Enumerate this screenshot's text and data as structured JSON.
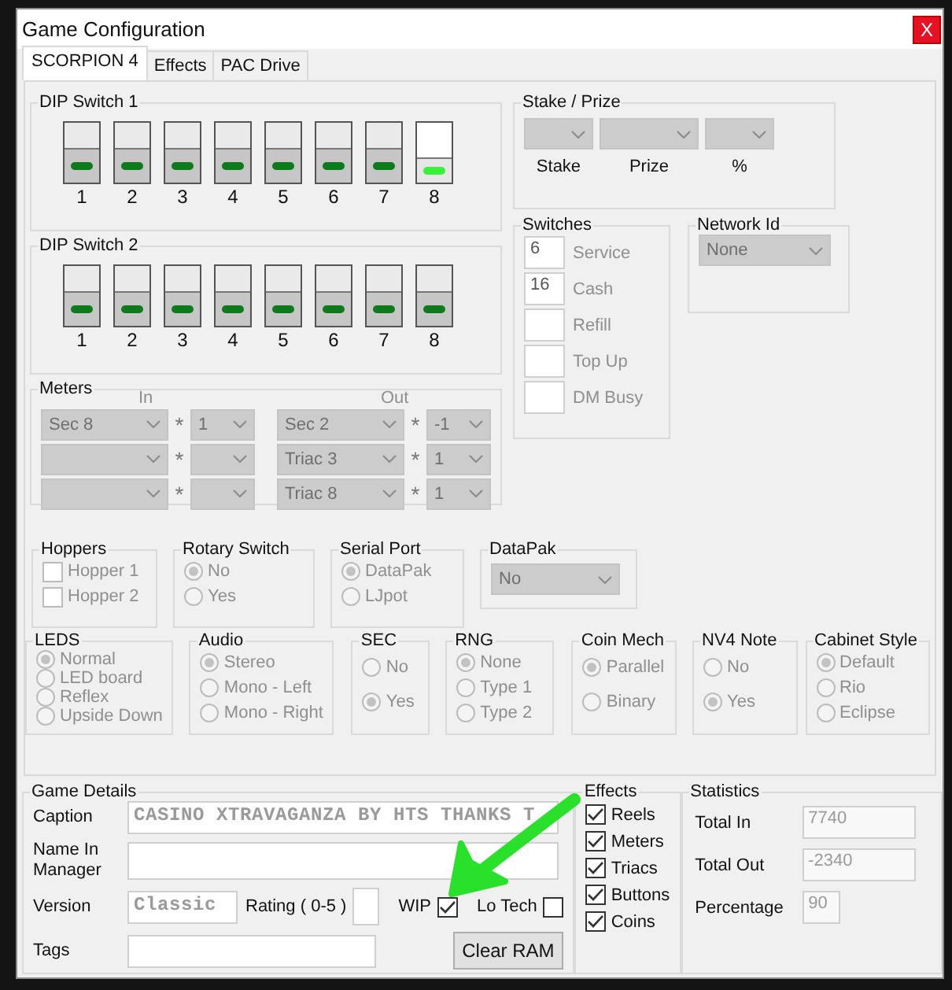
{
  "window": {
    "title": "Game Configuration",
    "close_label": "X"
  },
  "tabs": [
    {
      "label": "SCORPION 4",
      "selected": true
    },
    {
      "label": "Effects",
      "selected": false
    },
    {
      "label": "PAC Drive",
      "selected": false
    }
  ],
  "dip_switches": [
    {
      "title": "DIP Switch 1",
      "switches": [
        {
          "label": "1",
          "on": false
        },
        {
          "label": "2",
          "on": false
        },
        {
          "label": "3",
          "on": false
        },
        {
          "label": "4",
          "on": false
        },
        {
          "label": "5",
          "on": false
        },
        {
          "label": "6",
          "on": false
        },
        {
          "label": "7",
          "on": false
        },
        {
          "label": "8",
          "on": true
        }
      ]
    },
    {
      "title": "DIP Switch 2",
      "switches": [
        {
          "label": "1",
          "on": false
        },
        {
          "label": "2",
          "on": false
        },
        {
          "label": "3",
          "on": false
        },
        {
          "label": "4",
          "on": false
        },
        {
          "label": "5",
          "on": false
        },
        {
          "label": "6",
          "on": false
        },
        {
          "label": "7",
          "on": false
        },
        {
          "label": "8",
          "on": false
        }
      ]
    }
  ],
  "meters": {
    "title": "Meters",
    "in_label": "In",
    "out_label": "Out",
    "rows": [
      {
        "in_source": "Sec 8",
        "in_op": "*",
        "in_factor": "1",
        "out_source": "Sec 2",
        "out_op": "*",
        "out_factor": "-1"
      },
      {
        "in_op": "*",
        "out_source": "Triac 3",
        "out_op": "*",
        "out_factor": "1"
      },
      {
        "in_op": "*",
        "out_source": "Triac 8",
        "out_op": "*",
        "out_factor": "1"
      }
    ]
  },
  "stake_prize": {
    "title": "Stake / Prize",
    "fields": [
      {
        "label": "Stake"
      },
      {
        "label": "Prize"
      },
      {
        "label": "%"
      }
    ]
  },
  "switches": {
    "title": "Switches",
    "items": [
      {
        "value": "6",
        "label": "Service"
      },
      {
        "value": "16",
        "label": "Cash"
      },
      {
        "label": "Refill"
      },
      {
        "label": "Top Up"
      },
      {
        "label": "DM Busy"
      }
    ]
  },
  "network_id": {
    "title": "Network Id",
    "value": "None"
  },
  "option_rows": [
    [
      {
        "title": "Hoppers",
        "kind": "checkbox",
        "disabled": true,
        "options": [
          {
            "label": "Hopper 1",
            "checked": false
          },
          {
            "label": "Hopper 2",
            "checked": false
          }
        ]
      },
      {
        "title": "Rotary Switch",
        "kind": "radio",
        "disabled": true,
        "options": [
          {
            "label": "No",
            "selected": true
          },
          {
            "label": "Yes",
            "selected": false
          }
        ]
      },
      {
        "title": "Serial Port",
        "kind": "radio",
        "disabled": true,
        "options": [
          {
            "label": "DataPak",
            "selected": true
          },
          {
            "label": "LJpot",
            "selected": false
          }
        ]
      },
      {
        "title": "DataPak",
        "kind": "select",
        "disabled": true,
        "value": "No"
      }
    ],
    [
      {
        "title": "LEDS",
        "kind": "radio",
        "disabled": true,
        "options": [
          {
            "label": "Normal",
            "selected": true
          },
          {
            "label": "LED board",
            "selected": false
          },
          {
            "label": "Reflex",
            "selected": false
          },
          {
            "label": "Upside Down",
            "selected": false
          }
        ]
      },
      {
        "title": "Audio",
        "kind": "radio",
        "disabled": true,
        "options": [
          {
            "label": "Stereo",
            "selected": true
          },
          {
            "label": "Mono - Left",
            "selected": false
          },
          {
            "label": "Mono - Right",
            "selected": false
          }
        ]
      },
      {
        "title": "SEC",
        "kind": "radio",
        "disabled": true,
        "options": [
          {
            "label": "No",
            "selected": false
          },
          {
            "label": "Yes",
            "selected": true
          }
        ]
      },
      {
        "title": "RNG",
        "kind": "radio",
        "disabled": true,
        "options": [
          {
            "label": "None",
            "selected": true
          },
          {
            "label": "Type 1",
            "selected": false
          },
          {
            "label": "Type 2",
            "selected": false
          }
        ]
      },
      {
        "title": "Coin Mech",
        "kind": "radio",
        "disabled": true,
        "options": [
          {
            "label": "Parallel",
            "selected": true
          },
          {
            "label": "Binary",
            "selected": false
          }
        ]
      },
      {
        "title": "NV4 Note",
        "kind": "radio",
        "disabled": true,
        "options": [
          {
            "label": "No",
            "selected": false
          },
          {
            "label": "Yes",
            "selected": true
          }
        ]
      },
      {
        "title": "Cabinet Style",
        "kind": "radio",
        "disabled": true,
        "options": [
          {
            "label": "Default",
            "selected": true
          },
          {
            "label": "Rio",
            "selected": false
          },
          {
            "label": "Eclipse",
            "selected": false
          }
        ]
      }
    ]
  ],
  "game_details": {
    "title": "Game Details",
    "caption": {
      "label": "Caption",
      "value": "CASINO XTRAVAGANZA BY HTS THANKS T"
    },
    "name_in_manager": {
      "label": "Name In Manager"
    },
    "version": {
      "label": "Version",
      "value": "Classic"
    },
    "rating": {
      "label": "Rating ( 0-5 )"
    },
    "flags": [
      {
        "label": "WIP",
        "checked": true
      },
      {
        "label": "Lo Tech",
        "checked": false
      }
    ],
    "tags": {
      "label": "Tags"
    },
    "button": "Clear RAM"
  },
  "effects": {
    "title": "Effects",
    "disabled": false,
    "options": [
      {
        "label": "Reels",
        "checked": true
      },
      {
        "label": "Meters",
        "checked": true
      },
      {
        "label": "Triacs",
        "checked": true
      },
      {
        "label": "Buttons",
        "checked": true
      },
      {
        "label": "Coins",
        "checked": true
      }
    ]
  },
  "statistics": {
    "title": "Statistics",
    "fields": [
      {
        "label": "Total In",
        "value": "7740"
      },
      {
        "label": "Total Out",
        "value": "-2340"
      },
      {
        "label": "Percentage",
        "value": "90"
      }
    ]
  }
}
